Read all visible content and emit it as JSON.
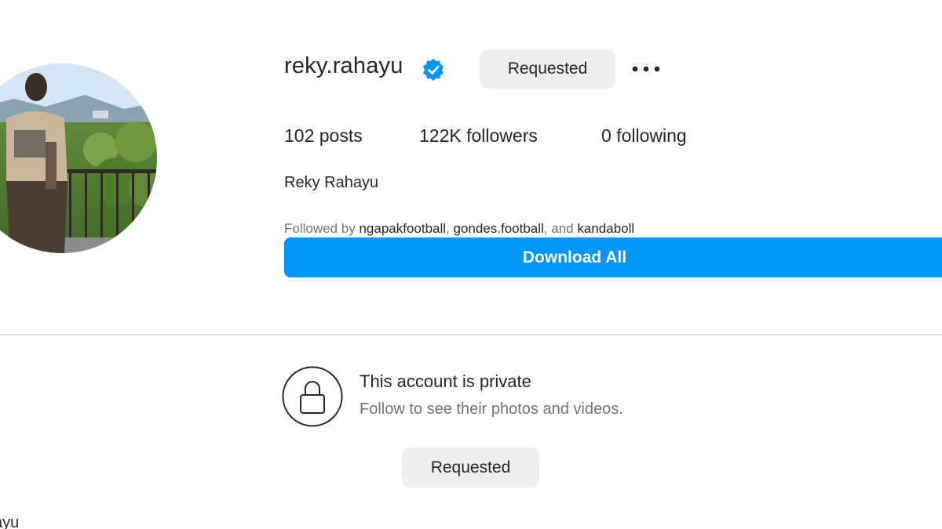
{
  "profile": {
    "username": "reky.rahayu",
    "full_name": "Reky Rahayu",
    "requested_label": "Requested",
    "stats": {
      "posts": "102",
      "posts_label": "posts",
      "followers": "122K",
      "followers_label": "followers",
      "following": "0",
      "following_label": "following"
    },
    "followed_by": {
      "prefix": "Followed by",
      "accounts": [
        "ngapakfootball",
        "gondes.football",
        "kandaboll"
      ],
      "sep1": ", ",
      "sep2": ", and "
    },
    "download_label": "Download All"
  },
  "private_notice": {
    "title": "This account is private",
    "subtitle": "Follow to see their photos and videos.",
    "button_label": "Requested"
  },
  "footer_cut_text": "ayu",
  "colors": {
    "accent": "#0095f6",
    "verified": "#0095f6",
    "button_bg": "#efefef",
    "text_primary": "#262626",
    "text_secondary": "#737373",
    "divider": "#dbdbdb"
  },
  "icons": {
    "verified": "verified-badge-icon",
    "more": "more-options-icon",
    "lock": "lock-icon"
  }
}
